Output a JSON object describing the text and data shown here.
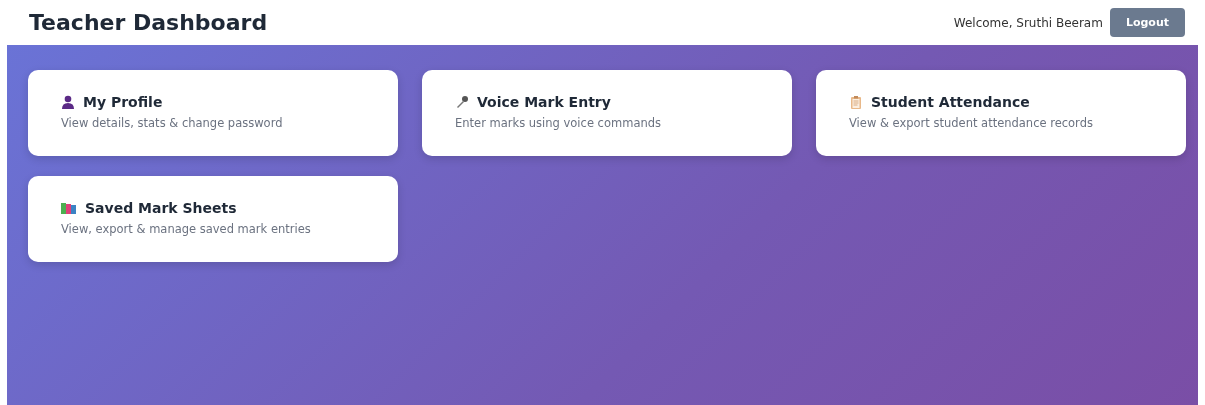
{
  "header": {
    "title": "Teacher Dashboard",
    "welcome": "Welcome, Sruthi Beeram",
    "logout": "Logout"
  },
  "cards": [
    {
      "kind": "profile",
      "title": "My Profile",
      "description": "View details, stats & change password"
    },
    {
      "kind": "voice",
      "title": "Voice Mark Entry",
      "description": "Enter marks using voice commands"
    },
    {
      "kind": "attendance",
      "title": "Student Attendance",
      "description": "View & export student attendance records"
    },
    {
      "kind": "sheets",
      "title": "Saved Mark Sheets",
      "description": "View, export & manage saved mark entries"
    }
  ]
}
